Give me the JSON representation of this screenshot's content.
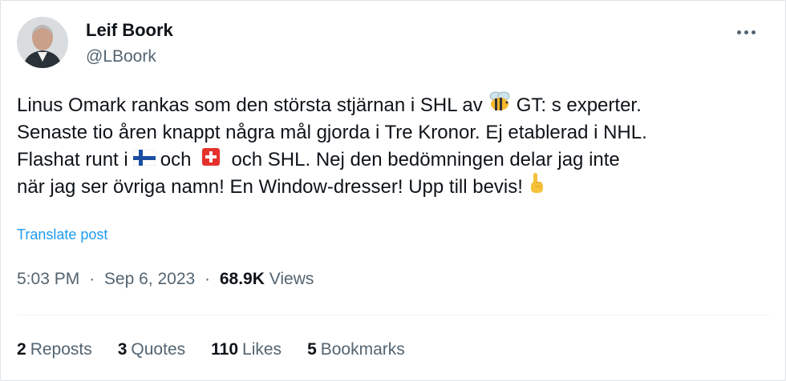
{
  "author": {
    "name": "Leif Boork",
    "handle": "@LBoork"
  },
  "tweet": {
    "line1_a": "Linus Omark rankas som den största stjärnan i SHL av",
    "line1_b": "GT: s experter.",
    "line2": "Senaste tio åren knappt några mål gjorda i Tre Kronor. Ej etablerad i NHL.",
    "line3_a": "Flashat runt i",
    "line3_b": "och",
    "line3_c": "och SHL. Nej den bedömningen delar jag inte",
    "line4": "när jag ser övriga namn! En Window-dresser! Upp till bevis!"
  },
  "translate_label": "Translate post",
  "meta": {
    "time": "5:03 PM",
    "separator": "·",
    "date": "Sep 6, 2023",
    "views_count": "68.9K",
    "views_label": "Views"
  },
  "stats": {
    "reposts_count": "2",
    "reposts_label": "Reposts",
    "quotes_count": "3",
    "quotes_label": "Quotes",
    "likes_count": "110",
    "likes_label": "Likes",
    "bookmarks_count": "5",
    "bookmarks_label": "Bookmarks"
  },
  "icons": {
    "bee": "bee-emoji",
    "finland_flag": "finland-flag-emoji",
    "swiss_flag": "switzerland-flag-emoji",
    "pointing_up": "pointing-up-emoji",
    "more": "more-icon"
  },
  "colors": {
    "link": "#1d9bf0",
    "secondary_text": "#536471",
    "primary_text": "#0f1419"
  }
}
